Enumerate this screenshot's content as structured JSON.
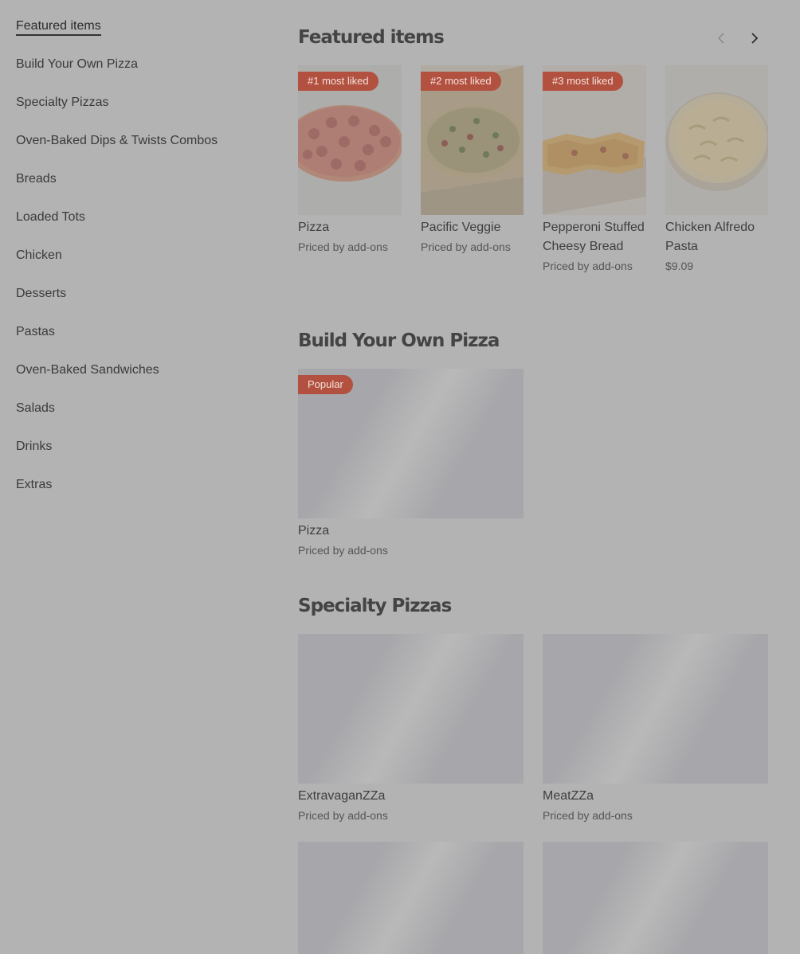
{
  "sidebar": {
    "items": [
      {
        "label": "Featured items"
      },
      {
        "label": "Build Your Own Pizza"
      },
      {
        "label": "Specialty Pizzas"
      },
      {
        "label": "Oven-Baked Dips & Twists Combos"
      },
      {
        "label": "Breads"
      },
      {
        "label": "Loaded Tots"
      },
      {
        "label": "Chicken"
      },
      {
        "label": "Desserts"
      },
      {
        "label": "Pastas"
      },
      {
        "label": "Oven-Baked Sandwiches"
      },
      {
        "label": "Salads"
      },
      {
        "label": "Drinks"
      },
      {
        "label": "Extras"
      }
    ]
  },
  "featured": {
    "title": "Featured items",
    "prev_icon": "chevron-left-icon",
    "next_icon": "chevron-right-icon",
    "items": [
      {
        "badge": "#1 most liked",
        "name": "Pizza",
        "price": "Priced by add-ons"
      },
      {
        "badge": "#2 most liked",
        "name": "Pacific Veggie",
        "price": "Priced by add-ons"
      },
      {
        "badge": "#3 most liked",
        "name": "Pepperoni Stuffed Cheesy Bread",
        "price": "Priced by add-ons"
      },
      {
        "name": "Chicken Alfredo Pasta",
        "price": "$9.09"
      }
    ]
  },
  "byo": {
    "title": "Build Your Own Pizza",
    "items": [
      {
        "badge": "Popular",
        "name": "Pizza",
        "price": "Priced by add-ons"
      }
    ]
  },
  "specialty": {
    "title": "Specialty Pizzas",
    "items": [
      {
        "name": "ExtravaganZZa",
        "price": "Priced by add-ons"
      },
      {
        "name": "MeatZZa",
        "price": "Priced by add-ons"
      }
    ]
  },
  "colors": {
    "overlay_bg": "#b3b3b3",
    "badge_bg": "#b35140",
    "placeholder": "#a7a7ab"
  }
}
